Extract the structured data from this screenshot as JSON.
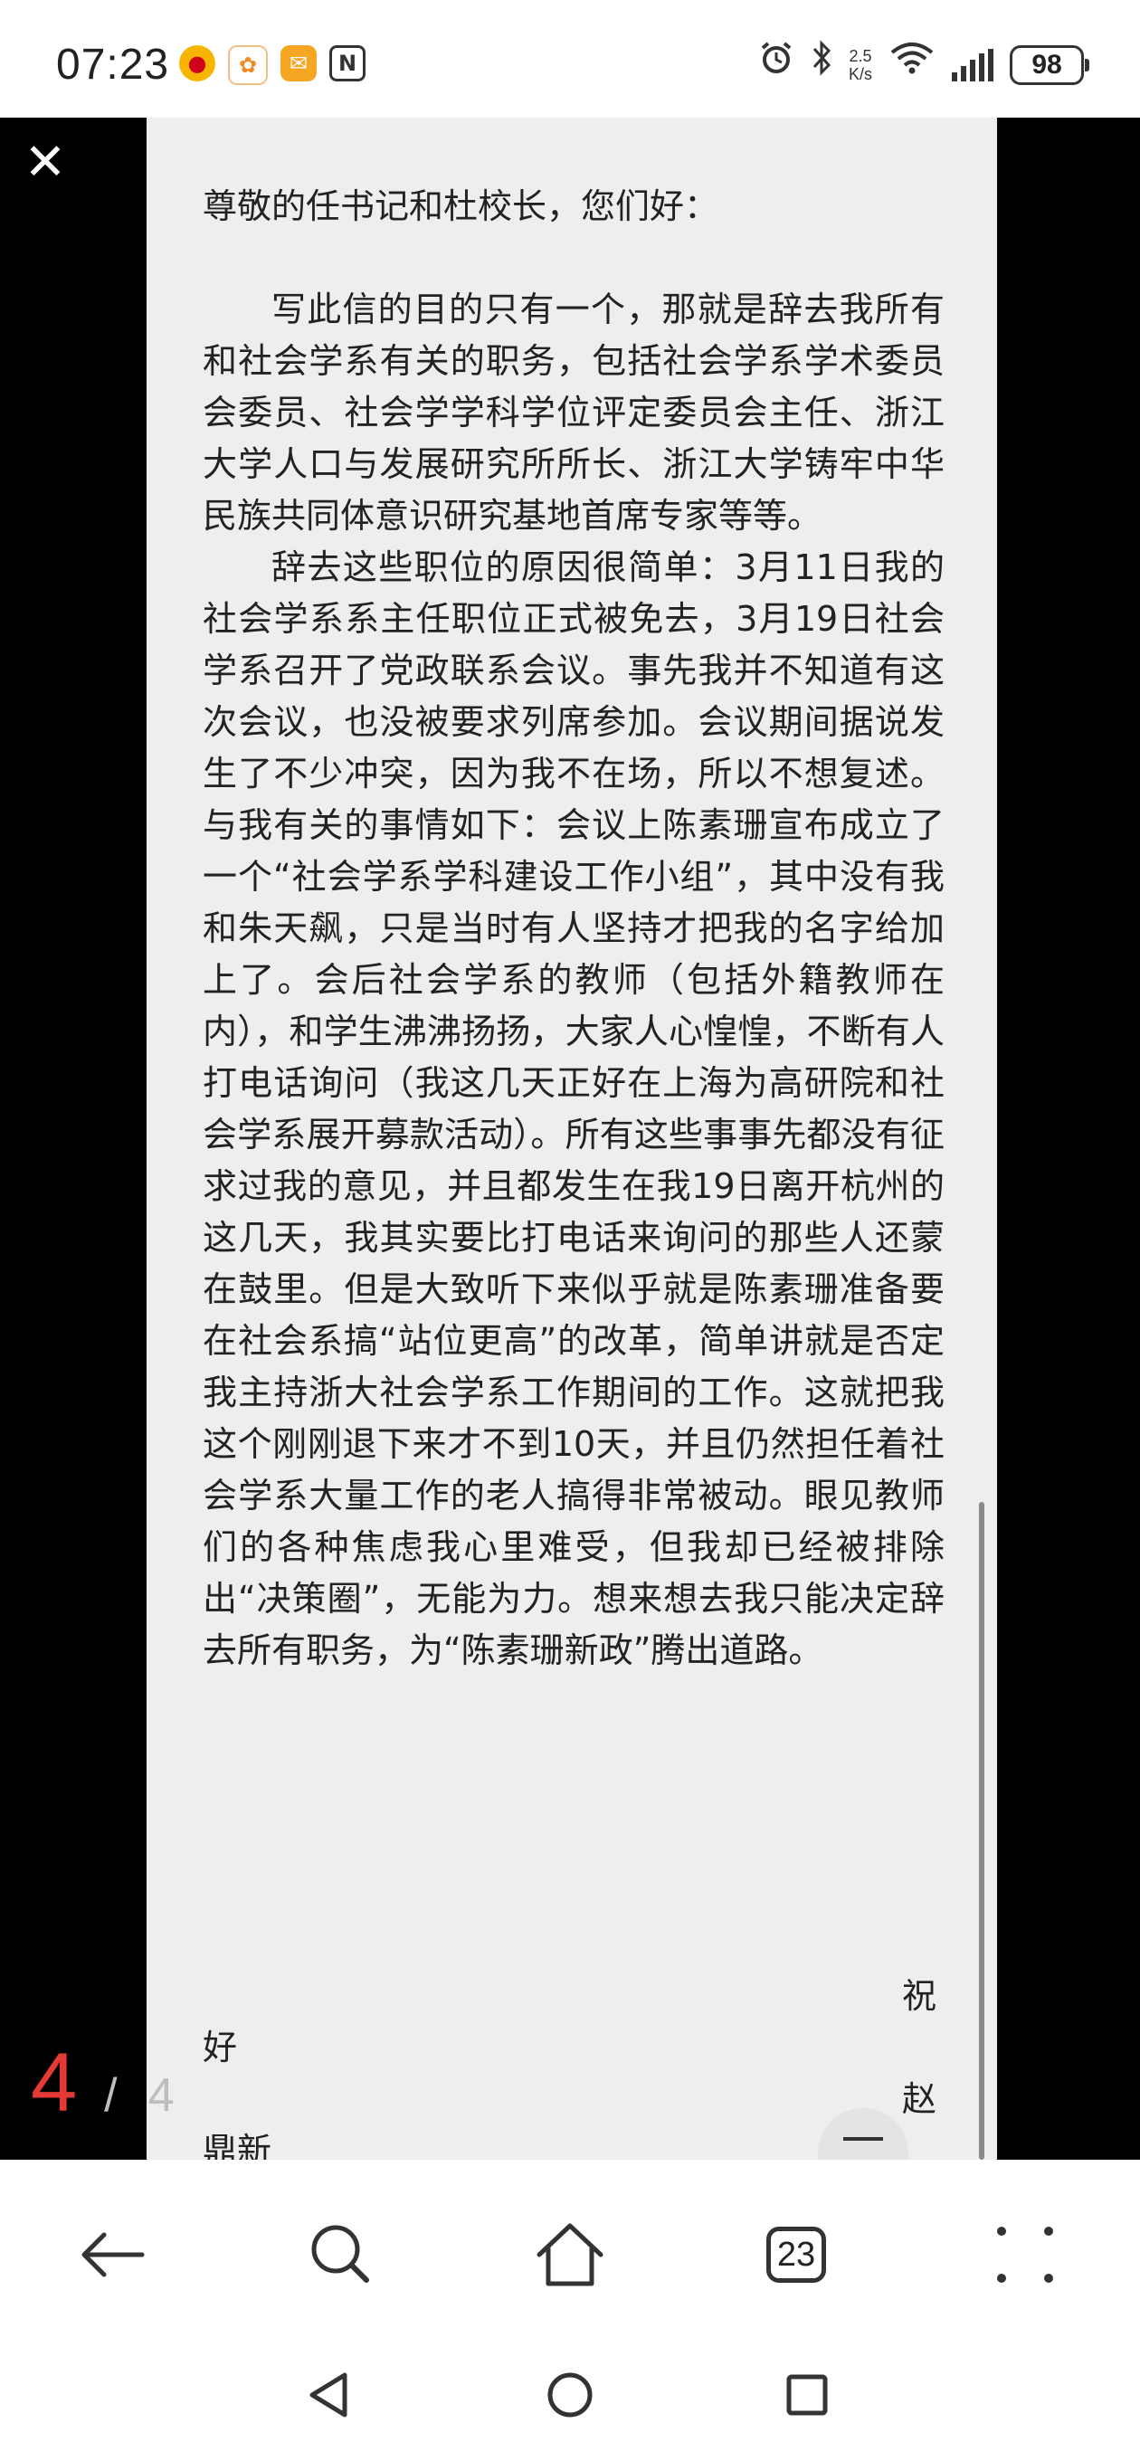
{
  "status_bar": {
    "time": "07:23",
    "notification_icons": [
      "weibo-icon",
      "app-icon",
      "mail-icon",
      "nfc-icon"
    ],
    "net_speed_value": "2.5",
    "net_speed_unit": "K/s",
    "battery": "98"
  },
  "viewer": {
    "close_glyph": "✕",
    "page_current": "4",
    "page_separator": "/",
    "page_total": "4"
  },
  "letter": {
    "salutation": "尊敬的任书记和杜校长，您们好：",
    "paragraphs": [
      "写此信的目的只有一个，那就是辞去我所有和社会学系有关的职务，包括社会学系学术委员会委员、社会学学科学位评定委员会主任、浙江大学人口与发展研究所所长、浙江大学铸牢中华民族共同体意识研究基地首席专家等等。",
      "辞去这些职位的原因很简单：3月11日我的社会学系系主任职位正式被免去，3月19日社会学系召开了党政联系会议。事先我并不知道有这次会议，也没被要求列席参加。会议期间据说发生了不少冲突，因为我不在场，所以不想复述。与我有关的事情如下：会议上陈素珊宣布成立了一个“社会学系学科建设工作小组”，其中没有我和朱天飙，只是当时有人坚持才把我的名字给加上了。会后社会学系的教师（包括外籍教师在内），和学生沸沸扬扬，大家人心惶惶，不断有人打电话询问（我这几天正好在上海为高研院和社会学系展开募款活动）。所有这些事事先都没有征求过我的意见，并且都发生在我19日离开杭州的这几天，我其实要比打电话来询问的那些人还蒙在鼓里。但是大致听下来似乎就是陈素珊准备要在社会系搞“站位更高”的改革，简单讲就是否定我主持浙大社会学系工作期间的工作。这就把我这个刚刚退下来才不到10天，并且仍然担任着社会学系大量工作的老人搞得非常被动。眼见教师们的各种焦虑我心里难受，但我却已经被排除出“决策圈”，无能为力。想来想去我只能决定辞去所有职务，为“陈素珊新政”腾出道路。"
    ],
    "closing_wish_1": "祝",
    "closing_wish_2": "好",
    "signature_1": "赵",
    "signature_2": "鼎新"
  },
  "toolbar": {
    "tabs_count": "23"
  }
}
